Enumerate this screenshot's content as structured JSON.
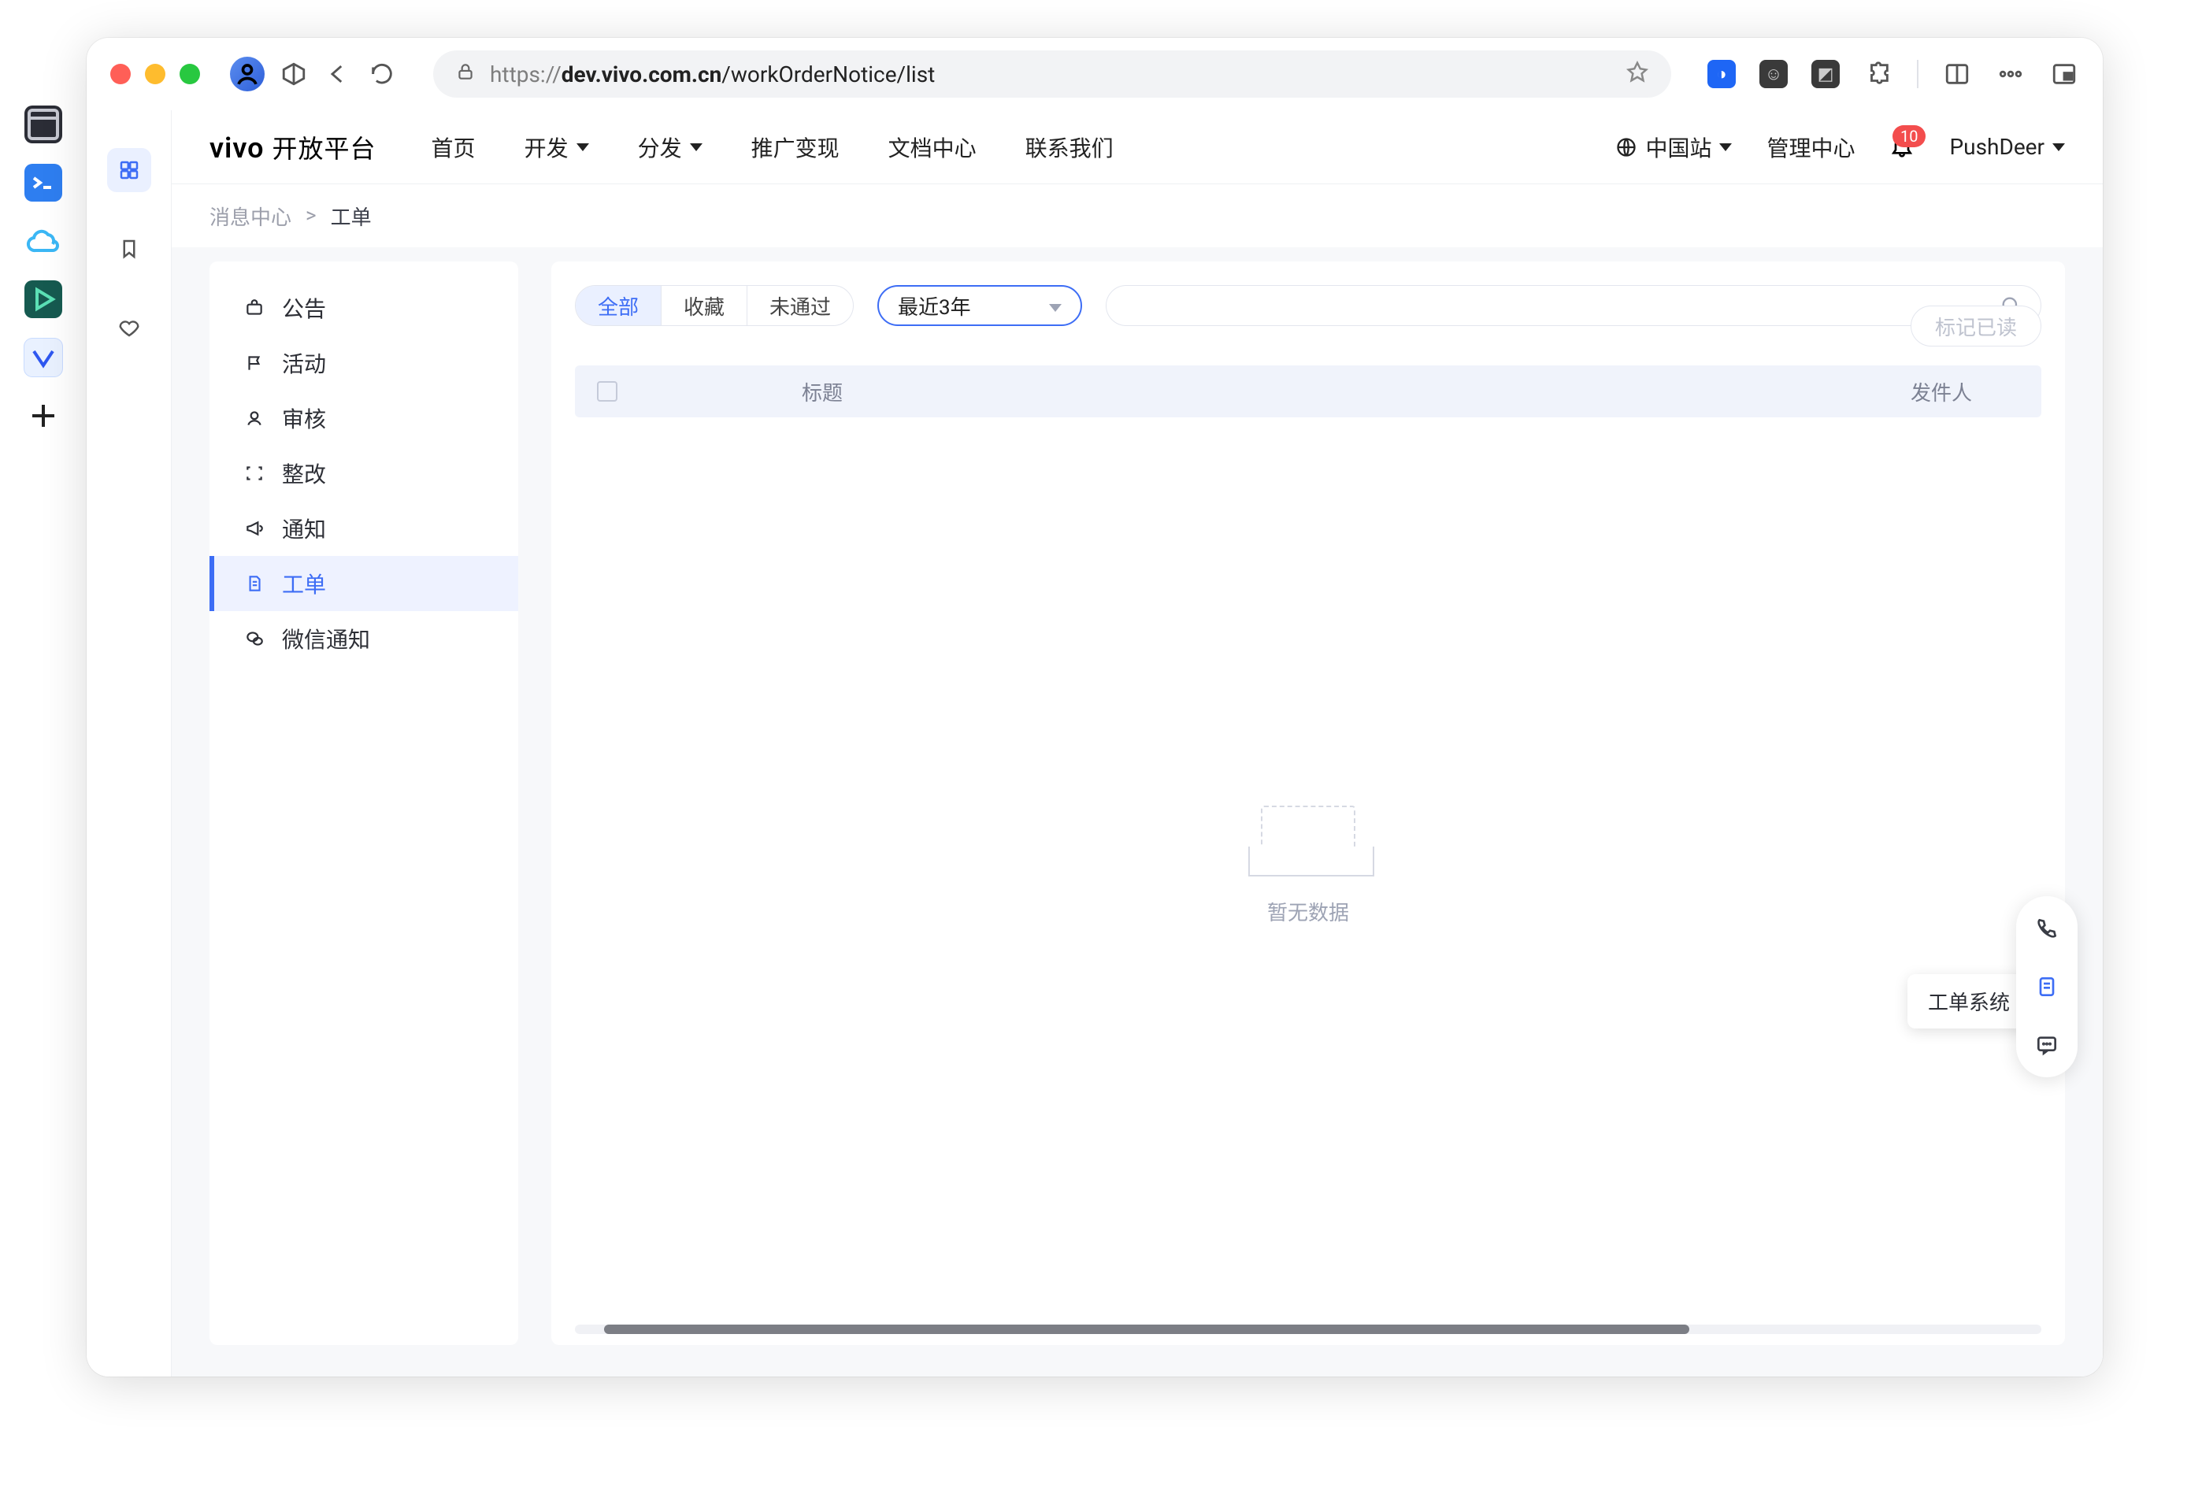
{
  "browser": {
    "url_prefix": "https://",
    "url_host": "dev.vivo.com.cn",
    "url_path": "/workOrderNotice/list"
  },
  "brand": {
    "name": "vivo",
    "suffix": "开放平台"
  },
  "top_nav": {
    "items": [
      "首页",
      "开发",
      "分发",
      "推广变现",
      "文档中心",
      "联系我们"
    ],
    "region": "中国站",
    "manage": "管理中心",
    "notifications": "10",
    "user": "PushDeer"
  },
  "breadcrumb": {
    "root": "消息中心",
    "current": "工单"
  },
  "side_menu": {
    "items": [
      {
        "icon": "briefcase",
        "label": "公告"
      },
      {
        "icon": "flag",
        "label": "活动"
      },
      {
        "icon": "user",
        "label": "审核"
      },
      {
        "icon": "scan",
        "label": "整改"
      },
      {
        "icon": "megaphone",
        "label": "通知"
      },
      {
        "icon": "file",
        "label": "工单"
      },
      {
        "icon": "chat",
        "label": "微信通知"
      }
    ],
    "active_index": 5
  },
  "filters": {
    "segments": [
      "全部",
      "收藏",
      "未通过"
    ],
    "active_segment": 0,
    "period": "最近3年",
    "search_placeholder": ""
  },
  "table": {
    "columns": {
      "title": "标题",
      "sender": "发件人"
    },
    "rows": [],
    "empty_text": "暂无数据"
  },
  "actions": {
    "mark_read": "标记已读"
  },
  "float": {
    "tooltip": "工单系统"
  }
}
